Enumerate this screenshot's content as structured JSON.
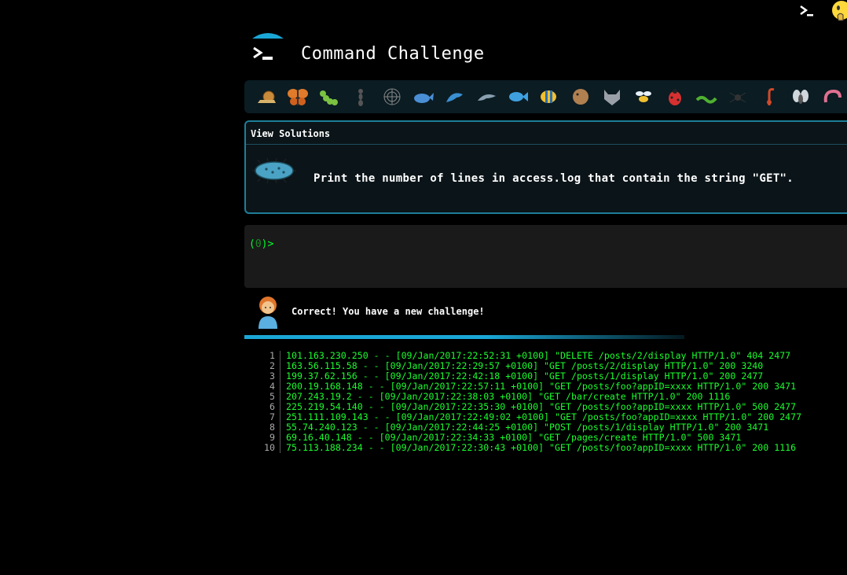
{
  "header": {
    "title": "Command Challenge"
  },
  "critters": [
    "snail-icon",
    "butterfly-icon",
    "caterpillar-icon",
    "ant-icon",
    "spider-web-icon",
    "whale-icon",
    "dolphin-icon",
    "dolphin-gray-icon",
    "fish-icon",
    "tropical-fish-icon",
    "blowfish-icon",
    "wolf-icon",
    "bee-icon",
    "ladybug-icon",
    "worm-icon",
    "spider-icon",
    "scorpion-icon",
    "fly-icon",
    "shrimp-icon"
  ],
  "challenge": {
    "view_solutions": "View Solutions",
    "text": "Print the number of lines in access.log that contain the string \"GET\"."
  },
  "terminal": {
    "prompt_open": "(",
    "prompt_count": "0",
    "prompt_close": ")>"
  },
  "feedback": {
    "message": "Correct! You have a new challenge!"
  },
  "log_lines": [
    {
      "num": "1",
      "text": "101.163.230.250 - - [09/Jan/2017:22:52:31 +0100] \"DELETE /posts/2/display HTTP/1.0\" 404 2477"
    },
    {
      "num": "2",
      "text": "163.56.115.58 - - [09/Jan/2017:22:29:57 +0100] \"GET /posts/2/display HTTP/1.0\" 200 3240"
    },
    {
      "num": "3",
      "text": "199.37.62.156 - - [09/Jan/2017:22:42:18 +0100] \"GET /posts/1/display HTTP/1.0\" 200 2477"
    },
    {
      "num": "4",
      "text": "200.19.168.148 - - [09/Jan/2017:22:57:11 +0100] \"GET /posts/foo?appID=xxxx HTTP/1.0\" 200 3471"
    },
    {
      "num": "5",
      "text": "207.243.19.2 - - [09/Jan/2017:22:38:03 +0100] \"GET /bar/create HTTP/1.0\" 200 1116"
    },
    {
      "num": "6",
      "text": "225.219.54.140 - - [09/Jan/2017:22:35:30 +0100] \"GET /posts/foo?appID=xxxx HTTP/1.0\" 500 2477"
    },
    {
      "num": "7",
      "text": "251.111.109.143 - - [09/Jan/2017:22:49:02 +0100] \"GET /posts/foo?appID=xxxx HTTP/1.0\" 200 2477"
    },
    {
      "num": "8",
      "text": "55.74.240.123 - - [09/Jan/2017:22:44:25 +0100] \"POST /posts/1/display HTTP/1.0\" 200 3471"
    },
    {
      "num": "9",
      "text": "69.16.40.148 - - [09/Jan/2017:22:34:33 +0100] \"GET /pages/create HTTP/1.0\" 500 3471"
    },
    {
      "num": "10",
      "text": "75.113.188.234 - - [09/Jan/2017:22:30:43 +0100] \"GET /posts/foo?appID=xxxx HTTP/1.0\" 200 1116"
    }
  ],
  "colors": {
    "accent": "#1aa7d6",
    "terminal_green": "#1aff2e",
    "panel_border": "#1d7e99"
  }
}
